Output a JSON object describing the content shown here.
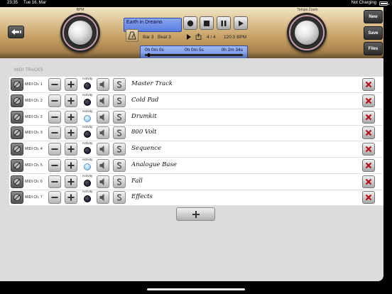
{
  "status": {
    "time": "23:35",
    "date": "Tue 16. Mar",
    "battery": "Not Charging"
  },
  "knobs": {
    "left_label": "BPM",
    "right_label": "Tempo Zoom"
  },
  "song": {
    "title": "Earth in Dreams",
    "bar": "Bar 3",
    "beat": "Beat 3",
    "time_signature": "4 / 4",
    "tempo": "120.0 BPM"
  },
  "timeline": {
    "start": "0h 0m 0s",
    "current": "0h 0m 5s",
    "end": "0h 2m 34s",
    "position": 0.03
  },
  "side_buttons": {
    "new": "New",
    "save": "Save",
    "files": "Files"
  },
  "tracks_header": "MIDI TRACKS",
  "activity_label": "Activity",
  "tracks": [
    {
      "channel": "MIDI Ch. 1",
      "name": "Master Track",
      "active": false
    },
    {
      "channel": "MIDI Ch. 2",
      "name": "Cold Pad",
      "active": false
    },
    {
      "channel": "MIDI Ch. 2",
      "name": "Drumkit",
      "active": true
    },
    {
      "channel": "MIDI Ch. 3",
      "name": "800 Volt",
      "active": false
    },
    {
      "channel": "MIDI Ch. 4",
      "name": "Sequence",
      "active": false
    },
    {
      "channel": "MIDI Ch. 5",
      "name": "Analogue Base",
      "active": true
    },
    {
      "channel": "MIDI Ch. 6",
      "name": "Fall",
      "active": false
    },
    {
      "channel": "MIDI Ch. 7",
      "name": "Effects",
      "active": false
    }
  ],
  "colors": {
    "lcd_blue": "#7292e6",
    "delete_red": "#b3131a",
    "led_lit": "#9ccff0"
  }
}
